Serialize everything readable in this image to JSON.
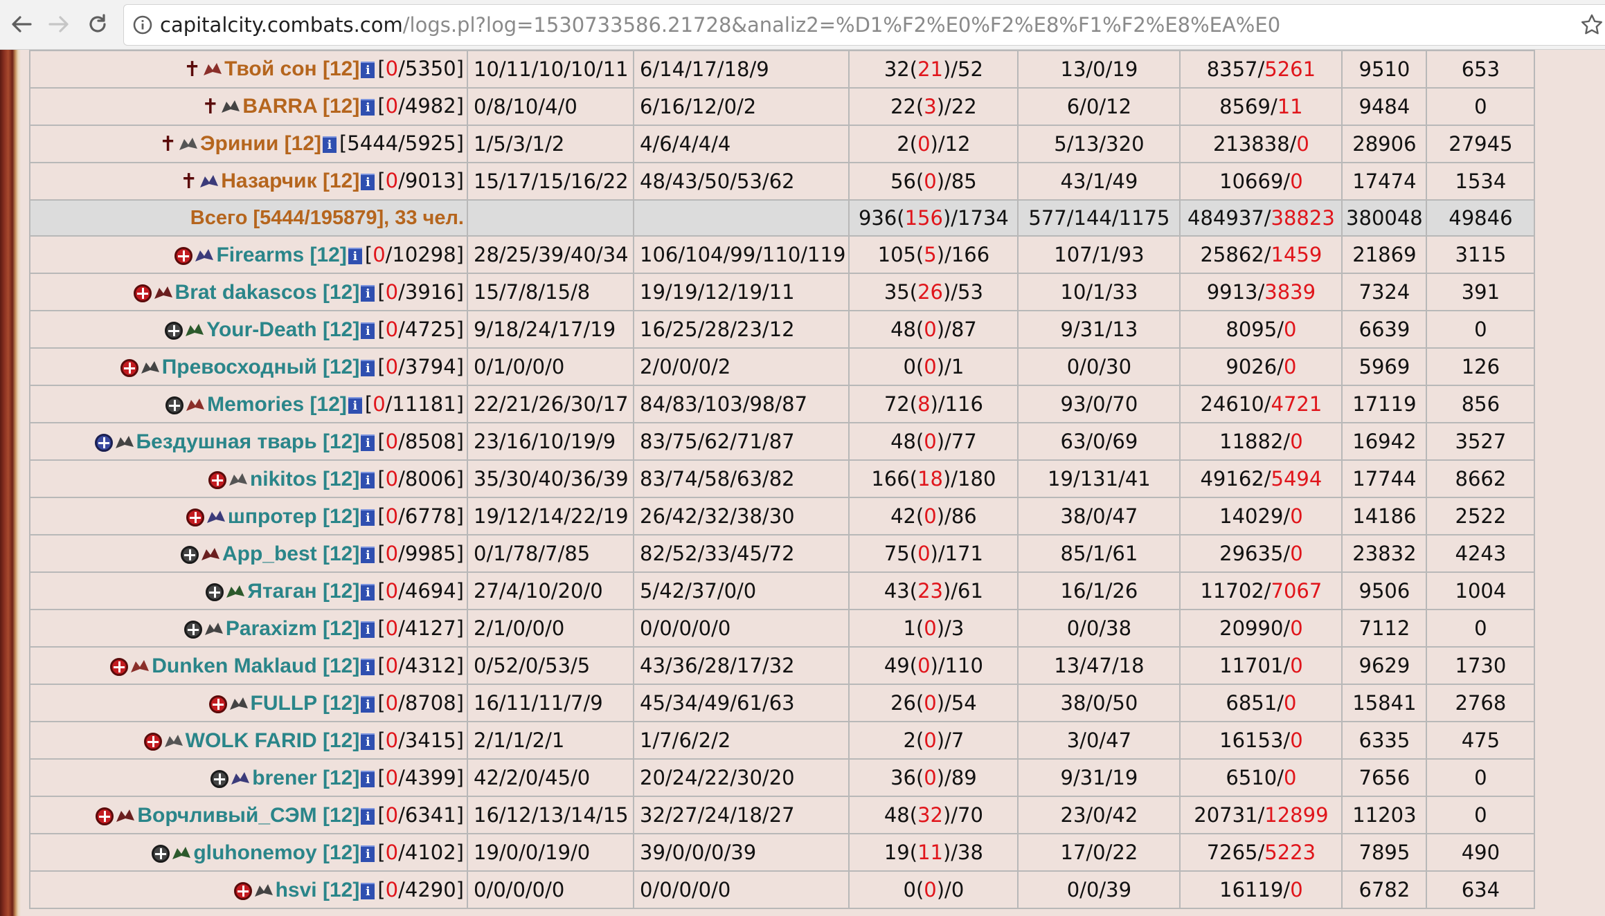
{
  "browser": {
    "url_host": "capitalcity.combats.com",
    "url_rest": "/logs.pl?log=1530733586.21728&analiz2=%D1%F2%E0%F2%E8%F1%F2%E8%EA%E0"
  },
  "top_rows": [
    {
      "mark": "cross",
      "nick": "Твой сон",
      "level": "[12]",
      "hp_a": "0",
      "hp_b": "/5350]",
      "c2": "10/11/10/10/11",
      "c3": "6/14/17/18/9",
      "d_a": "32(",
      "d_r": "21",
      "d_b": ")/52",
      "e": "13/0/19",
      "f_a": "8357/",
      "f_r": "5261",
      "g": "9510",
      "h": "653"
    },
    {
      "mark": "cross",
      "nick": "BARRA",
      "level": "[12]",
      "hp_a": "0",
      "hp_b": "/4982]",
      "c2": "0/8/10/4/0",
      "c3": "6/16/12/0/2",
      "d_a": "22(",
      "d_r": "3",
      "d_b": ")/22",
      "e": "6/0/12",
      "f_a": "8569/",
      "f_r": "11",
      "g": "9484",
      "h": "0"
    },
    {
      "mark": "cross",
      "nick": "Эринии",
      "level": "[12]",
      "hp_a": "",
      "hp_b": "5444/5925]",
      "c2": "1/5/3/1/2",
      "c3": "4/6/4/4/4",
      "d_a": "2(",
      "d_r": "0",
      "d_b": ")/12",
      "e": "5/13/320",
      "f_a": "213838/",
      "f_r": "0",
      "g": "28906",
      "h": "27945"
    },
    {
      "mark": "cross",
      "nick": "Назарчик",
      "level": "[12]",
      "hp_a": "0",
      "hp_b": "/9013]",
      "c2": "15/17/15/16/22",
      "c3": "48/43/50/53/62",
      "d_a": "56(",
      "d_r": "0",
      "d_b": ")/85",
      "e": "43/1/49",
      "f_a": "10669/",
      "f_r": "0",
      "g": "17474",
      "h": "1534"
    }
  ],
  "team_total": {
    "label": "Всего [5444/195879], 33 чел.",
    "d_a": "936(",
    "d_r": "156",
    "d_b": ")/1734",
    "e": "577/144/1175",
    "f_a": "484937/",
    "f_r": "38823",
    "g": "380048",
    "h": "49846"
  },
  "bottom_rows": [
    {
      "badge": "red",
      "nick": "Firearms",
      "level": "[12]",
      "hp_a": "0",
      "hp_b": "/10298]",
      "c2": "28/25/39/40/34",
      "c3": "106/104/99/110/119",
      "d_a": "105(",
      "d_r": "5",
      "d_b": ")/166",
      "e": "107/1/93",
      "f_a": "25862/",
      "f_r": "1459",
      "g": "21869",
      "h": "3115"
    },
    {
      "badge": "red",
      "nick": "Brat dakascos",
      "level": "[12]",
      "hp_a": "0",
      "hp_b": "/3916]",
      "c2": "15/7/8/15/8",
      "c3": "19/19/12/19/11",
      "d_a": "35(",
      "d_r": "26",
      "d_b": ")/53",
      "e": "10/1/33",
      "f_a": "9913/",
      "f_r": "3839",
      "g": "7324",
      "h": "391"
    },
    {
      "badge": "dark",
      "nick": "Your-Death",
      "level": "[12]",
      "hp_a": "0",
      "hp_b": "/4725]",
      "c2": "9/18/24/17/19",
      "c3": "16/25/28/23/12",
      "d_a": "48(",
      "d_r": "0",
      "d_b": ")/87",
      "e": "9/31/13",
      "f_a": "8095/",
      "f_r": "0",
      "g": "6639",
      "h": "0"
    },
    {
      "badge": "red",
      "nick": "Превосходный",
      "level": "[12]",
      "hp_a": "0",
      "hp_b": "/3794]",
      "c2": "0/1/0/0/0",
      "c3": "2/0/0/0/2",
      "d_a": "0(",
      "d_r": "0",
      "d_b": ")/1",
      "e": "0/0/30",
      "f_a": "9026/",
      "f_r": "0",
      "g": "5969",
      "h": "126"
    },
    {
      "badge": "dark",
      "nick": "Memories",
      "level": "[12]",
      "hp_a": "0",
      "hp_b": "/11181]",
      "c2": "22/21/26/30/17",
      "c3": "84/83/103/98/87",
      "d_a": "72(",
      "d_r": "8",
      "d_b": ")/116",
      "e": "93/0/70",
      "f_a": "24610/",
      "f_r": "4721",
      "g": "17119",
      "h": "856"
    },
    {
      "badge": "blue",
      "nick": "Бездушная тварь",
      "level": "[12]",
      "hp_a": "0",
      "hp_b": "/8508]",
      "c2": "23/16/10/19/9",
      "c3": "83/75/62/71/87",
      "d_a": "48(",
      "d_r": "0",
      "d_b": ")/77",
      "e": "63/0/69",
      "f_a": "11882/",
      "f_r": "0",
      "g": "16942",
      "h": "3527"
    },
    {
      "badge": "red",
      "nick": "nikitos",
      "level": "[12]",
      "hp_a": "0",
      "hp_b": "/8006]",
      "c2": "35/30/40/36/39",
      "c3": "83/74/58/63/82",
      "d_a": "166(",
      "d_r": "18",
      "d_b": ")/180",
      "e": "19/131/41",
      "f_a": "49162/",
      "f_r": "5494",
      "g": "17744",
      "h": "8662"
    },
    {
      "badge": "red",
      "nick": "шпротер",
      "level": "[12]",
      "hp_a": "0",
      "hp_b": "/6778]",
      "c2": "19/12/14/22/19",
      "c3": "26/42/32/38/30",
      "d_a": "42(",
      "d_r": "0",
      "d_b": ")/86",
      "e": "38/0/47",
      "f_a": "14029/",
      "f_r": "0",
      "g": "14186",
      "h": "2522"
    },
    {
      "badge": "dark",
      "nick": "App_best",
      "level": "[12]",
      "hp_a": "0",
      "hp_b": "/9985]",
      "c2": "0/1/78/7/85",
      "c3": "82/52/33/45/72",
      "d_a": "75(",
      "d_r": "0",
      "d_b": ")/171",
      "e": "85/1/61",
      "f_a": "29635/",
      "f_r": "0",
      "g": "23832",
      "h": "4243"
    },
    {
      "badge": "dark",
      "nick": "Ятаган",
      "level": "[12]",
      "hp_a": "0",
      "hp_b": "/4694]",
      "c2": "27/4/10/20/0",
      "c3": "5/42/37/0/0",
      "d_a": "43(",
      "d_r": "23",
      "d_b": ")/61",
      "e": "16/1/26",
      "f_a": "11702/",
      "f_r": "7067",
      "g": "9506",
      "h": "1004"
    },
    {
      "badge": "dark",
      "nick": "Paraxizm",
      "level": "[12]",
      "hp_a": "0",
      "hp_b": "/4127]",
      "c2": "2/1/0/0/0",
      "c3": "0/0/0/0/0",
      "d_a": "1(",
      "d_r": "0",
      "d_b": ")/3",
      "e": "0/0/38",
      "f_a": "20990/",
      "f_r": "0",
      "g": "7112",
      "h": "0"
    },
    {
      "badge": "red",
      "nick": "Dunken Maklaud",
      "level": "[12]",
      "hp_a": "0",
      "hp_b": "/4312]",
      "c2": "0/52/0/53/5",
      "c3": "43/36/28/17/32",
      "d_a": "49(",
      "d_r": "0",
      "d_b": ")/110",
      "e": "13/47/18",
      "f_a": "11701/",
      "f_r": "0",
      "g": "9629",
      "h": "1730"
    },
    {
      "badge": "red",
      "nick": "FULLP",
      "level": "[12]",
      "hp_a": "0",
      "hp_b": "/8708]",
      "c2": "16/11/11/7/9",
      "c3": "45/34/49/61/63",
      "d_a": "26(",
      "d_r": "0",
      "d_b": ")/54",
      "e": "38/0/50",
      "f_a": "6851/",
      "f_r": "0",
      "g": "15841",
      "h": "2768"
    },
    {
      "badge": "red",
      "nick": "WOLK FARID",
      "level": "[12]",
      "hp_a": "0",
      "hp_b": "/3415]",
      "c2": "2/1/1/2/1",
      "c3": "1/7/6/2/2",
      "d_a": "2(",
      "d_r": "0",
      "d_b": ")/7",
      "e": "3/0/47",
      "f_a": "16153/",
      "f_r": "0",
      "g": "6335",
      "h": "475"
    },
    {
      "badge": "dark",
      "nick": "brener",
      "level": "[12]",
      "hp_a": "0",
      "hp_b": "/4399]",
      "c2": "42/2/0/45/0",
      "c3": "20/24/22/30/20",
      "d_a": "36(",
      "d_r": "0",
      "d_b": ")/89",
      "e": "9/31/19",
      "f_a": "6510/",
      "f_r": "0",
      "g": "7656",
      "h": "0"
    },
    {
      "badge": "red",
      "nick": "Ворчливый_СЭМ",
      "level": "[12]",
      "hp_a": "0",
      "hp_b": "/6341]",
      "c2": "16/12/13/14/15",
      "c3": "32/27/24/18/27",
      "d_a": "48(",
      "d_r": "32",
      "d_b": ")/70",
      "e": "23/0/42",
      "f_a": "20731/",
      "f_r": "12899",
      "g": "11203",
      "h": "0"
    },
    {
      "badge": "dark",
      "nick": "gluhonemoy",
      "level": "[12]",
      "hp_a": "0",
      "hp_b": "/4102]",
      "c2": "19/0/0/19/0",
      "c3": "39/0/0/0/39",
      "d_a": "19(",
      "d_r": "11",
      "d_b": ")/38",
      "e": "17/0/22",
      "f_a": "7265/",
      "f_r": "5223",
      "g": "7895",
      "h": "490"
    },
    {
      "badge": "red",
      "nick": "hsvi",
      "level": "[12]",
      "hp_a": "0",
      "hp_b": "/4290]",
      "c2": "0/0/0/0/0",
      "c3": "0/0/0/0/0",
      "d_a": "0(",
      "d_r": "0",
      "d_b": ")/0",
      "e": "0/0/39",
      "f_a": "16119/",
      "f_r": "0",
      "g": "6782",
      "h": "634"
    }
  ]
}
